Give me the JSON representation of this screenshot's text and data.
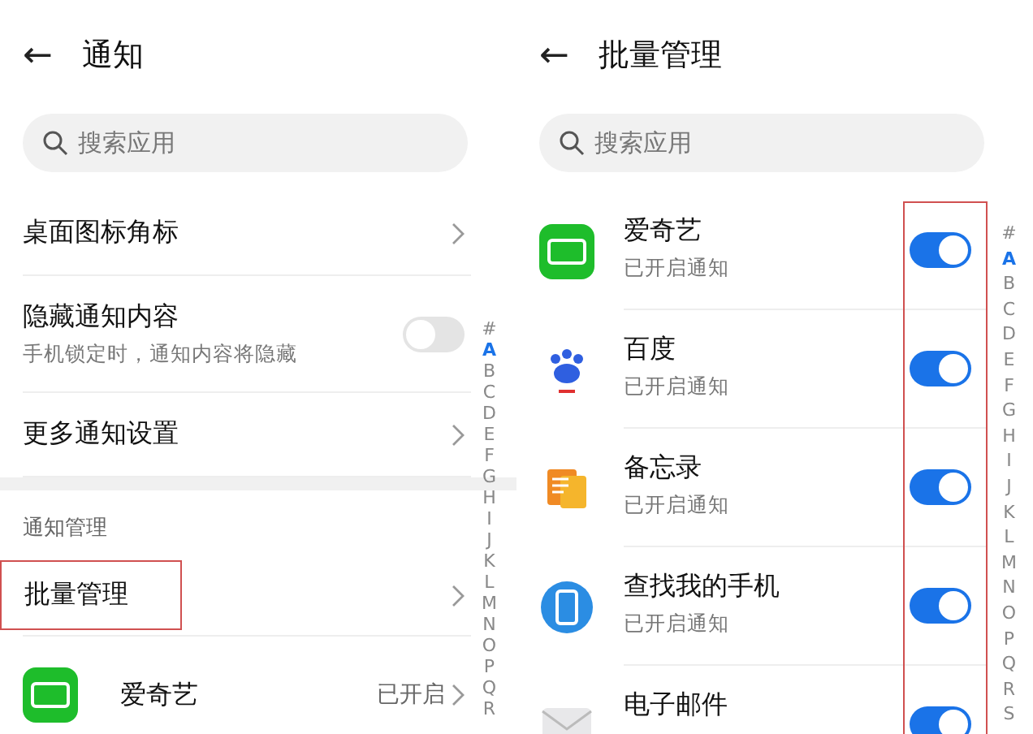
{
  "left": {
    "title": "通知",
    "back": "←",
    "search": {
      "placeholder": "搜索应用"
    },
    "settings": [
      {
        "kind": "link",
        "label": "桌面图标角标"
      },
      {
        "kind": "switch",
        "label": "隐藏通知内容",
        "sub": "手机锁定时，通知内容将隐藏",
        "on": false
      },
      {
        "kind": "link",
        "label": "更多通知设置"
      }
    ],
    "section": "通知管理",
    "manage": {
      "label": "批量管理",
      "highlighted": true
    },
    "apps": [
      {
        "name": "爱奇艺",
        "status": "已开启"
      }
    ],
    "index": [
      {
        "label": "#",
        "selected": false
      },
      {
        "label": "A",
        "selected": true
      },
      {
        "label": "B",
        "selected": false
      },
      {
        "label": "C",
        "selected": false
      },
      {
        "label": "D",
        "selected": false
      },
      {
        "label": "E",
        "selected": false
      },
      {
        "label": "F",
        "selected": false
      },
      {
        "label": "G",
        "selected": false
      },
      {
        "label": "H",
        "selected": false
      },
      {
        "label": "I",
        "selected": false
      },
      {
        "label": "J",
        "selected": false
      },
      {
        "label": "K",
        "selected": false
      },
      {
        "label": "L",
        "selected": false
      },
      {
        "label": "M",
        "selected": false
      },
      {
        "label": "N",
        "selected": false
      },
      {
        "label": "O",
        "selected": false
      },
      {
        "label": "P",
        "selected": false
      },
      {
        "label": "Q",
        "selected": false
      },
      {
        "label": "R",
        "selected": false
      }
    ]
  },
  "right": {
    "title": "批量管理",
    "back": "←",
    "search": {
      "placeholder": "搜索应用"
    },
    "switches_highlighted": true,
    "apps": [
      {
        "name": "爱奇艺",
        "sub": "已开启通知",
        "on": true
      },
      {
        "name": "百度",
        "sub": "已开启通知",
        "on": true
      },
      {
        "name": "备忘录",
        "sub": "已开启通知",
        "on": true
      },
      {
        "name": "查找我的手机",
        "sub": "已开启通知",
        "on": true
      },
      {
        "name": "电子邮件",
        "on": true
      }
    ],
    "index": [
      {
        "label": "#",
        "selected": false
      },
      {
        "label": "A",
        "selected": true
      },
      {
        "label": "B",
        "selected": false
      },
      {
        "label": "C",
        "selected": false
      },
      {
        "label": "D",
        "selected": false
      },
      {
        "label": "E",
        "selected": false
      },
      {
        "label": "F",
        "selected": false
      },
      {
        "label": "G",
        "selected": false
      },
      {
        "label": "H",
        "selected": false
      },
      {
        "label": "I",
        "selected": false
      },
      {
        "label": "J",
        "selected": false
      },
      {
        "label": "K",
        "selected": false
      },
      {
        "label": "L",
        "selected": false
      },
      {
        "label": "M",
        "selected": false
      },
      {
        "label": "N",
        "selected": false
      },
      {
        "label": "O",
        "selected": false
      },
      {
        "label": "P",
        "selected": false
      },
      {
        "label": "Q",
        "selected": false
      },
      {
        "label": "R",
        "selected": false
      },
      {
        "label": "S",
        "selected": false
      }
    ]
  }
}
